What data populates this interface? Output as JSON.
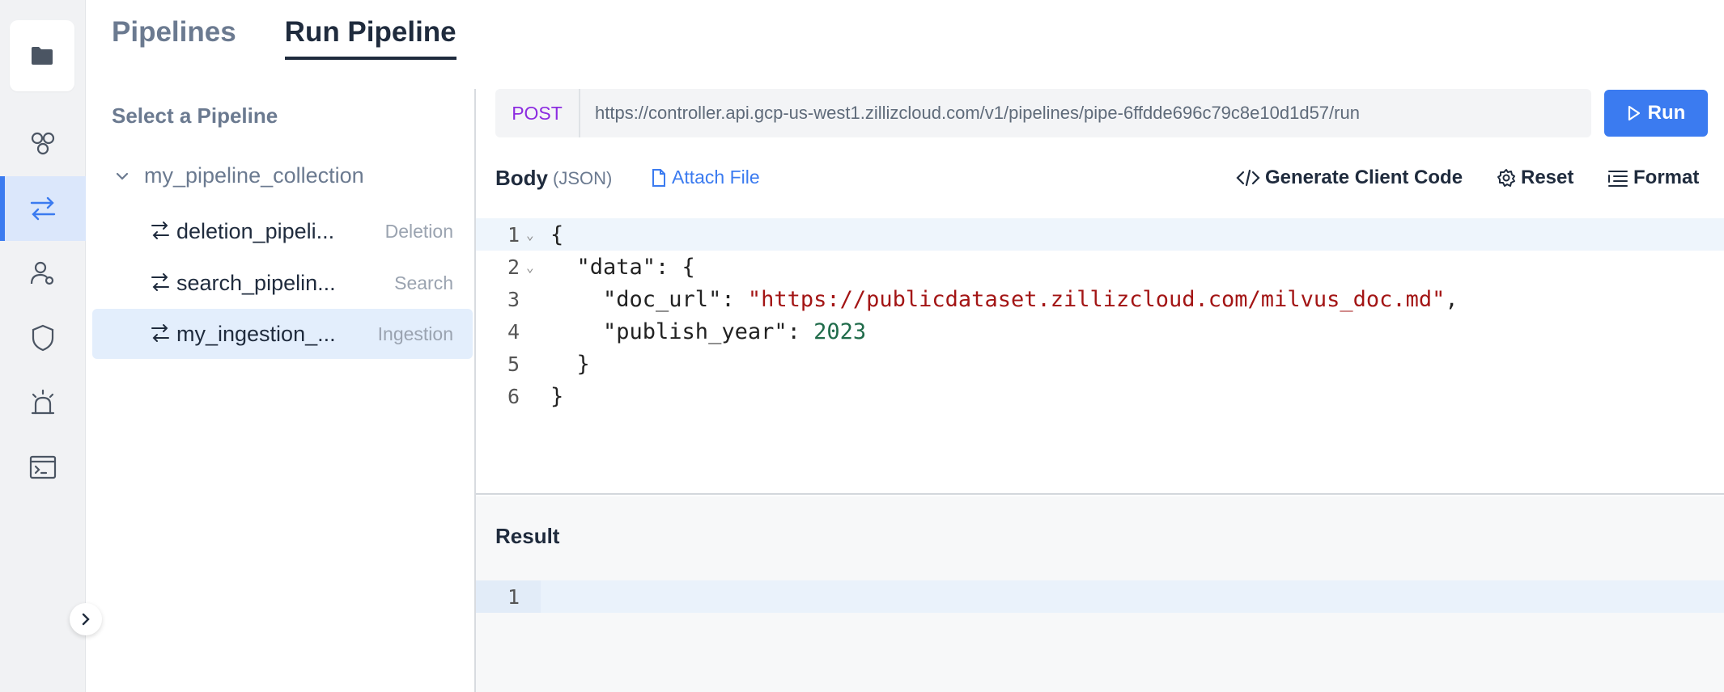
{
  "tabs": [
    {
      "label": "Pipelines",
      "active": false
    },
    {
      "label": "Run Pipeline",
      "active": true
    }
  ],
  "sidebar": {
    "title": "Select a Pipeline",
    "group": "my_pipeline_collection",
    "items": [
      {
        "name": "deletion_pipeli...",
        "type": "Deletion",
        "selected": false
      },
      {
        "name": "search_pipelin...",
        "type": "Search",
        "selected": false
      },
      {
        "name": "my_ingestion_...",
        "type": "Ingestion",
        "selected": true
      }
    ]
  },
  "rail": {
    "icons": [
      "folder-icon",
      "clusters-icon",
      "pipelines-icon",
      "users-icon",
      "security-icon",
      "alarm-icon",
      "terminal-icon"
    ],
    "active": "pipelines-icon"
  },
  "request": {
    "method": "POST",
    "url": "https://controller.api.gcp-us-west1.zillizcloud.com/v1/pipelines/pipe-6ffdde696c79c8e10d1d57/run",
    "run_label": "Run"
  },
  "body": {
    "label": "Body",
    "format": "(JSON)",
    "attach_label": "Attach File",
    "generate_label": "Generate Client Code",
    "reset_label": "Reset",
    "format_label": "Format",
    "lines": [
      {
        "n": "1",
        "text": "{"
      },
      {
        "n": "2",
        "text": "  \"data\": {"
      },
      {
        "n": "3",
        "key": "    \"doc_url\": ",
        "str": "\"https://publicdataset.zillizcloud.com/milvus_doc.md\"",
        "tail": ","
      },
      {
        "n": "4",
        "key": "    \"publish_year\": ",
        "num": "2023"
      },
      {
        "n": "5",
        "text": "  }"
      },
      {
        "n": "6",
        "text": "}"
      }
    ]
  },
  "result": {
    "title": "Result",
    "line_number": "1"
  },
  "colors": {
    "accent": "#3b7bf0",
    "method": "#8c2ce0",
    "string": "#a31515",
    "number": "#1f6b4a"
  }
}
